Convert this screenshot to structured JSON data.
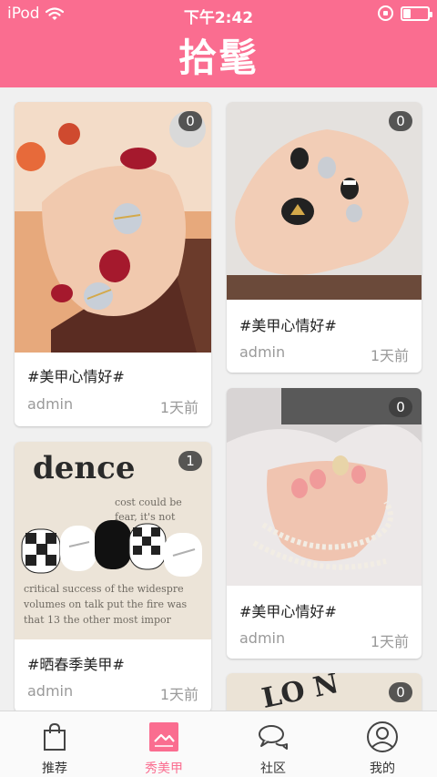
{
  "status_bar": {
    "carrier": "iPod",
    "time": "下午2:42",
    "battery_fraction": 0.3
  },
  "header": {
    "title": "拾髦"
  },
  "feed": {
    "cards": [
      {
        "tag": "#美甲心情好#",
        "author": "admin",
        "time": "1天前",
        "count": "0"
      },
      {
        "tag": "#美甲心情好#",
        "author": "admin",
        "time": "1天前",
        "count": "0"
      },
      {
        "tag": "#美甲心情好#",
        "author": "admin",
        "time": "1天前",
        "count": "0"
      },
      {
        "tag": "#晒春季美甲#",
        "author": "admin",
        "time": "1天前",
        "count": "1"
      },
      {
        "count": "0"
      }
    ]
  },
  "tab_bar": {
    "tabs": [
      {
        "label": "推荐",
        "icon": "shopping-bag-icon"
      },
      {
        "label": "秀美甲",
        "icon": "image-icon",
        "active": true
      },
      {
        "label": "社区",
        "icon": "chat-bubbles-icon"
      },
      {
        "label": "我的",
        "icon": "user-icon"
      }
    ]
  },
  "colors": {
    "brand": "#fa6d90",
    "background": "#f0f0f0",
    "muted_text": "#9a9a9a"
  }
}
